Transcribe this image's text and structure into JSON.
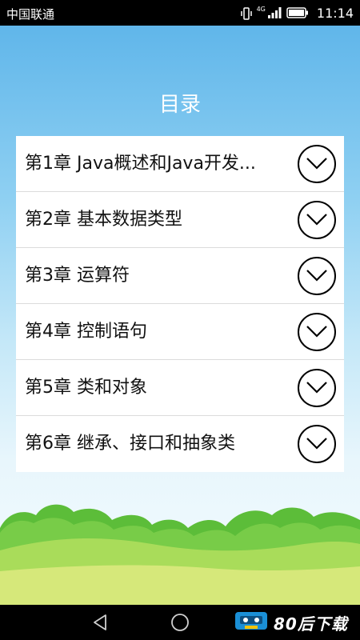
{
  "status_bar": {
    "carrier": "中国联通",
    "network_type": "4G",
    "time": "11:14"
  },
  "page": {
    "title": "目录"
  },
  "chapters": [
    {
      "label": "第1章 Java概述和Java开发..."
    },
    {
      "label": "第2章 基本数据类型"
    },
    {
      "label": "第3章 运算符"
    },
    {
      "label": "第4章 控制语句"
    },
    {
      "label": "第5章 类和对象"
    },
    {
      "label": "第6章 继承、接口和抽象类"
    }
  ],
  "watermark": {
    "text": "80后下载"
  },
  "colors": {
    "sky_top": "#60b6ea",
    "hill_dark": "#5fbf3a",
    "hill_light": "#a9dc5a",
    "ground": "#d6e87a"
  }
}
